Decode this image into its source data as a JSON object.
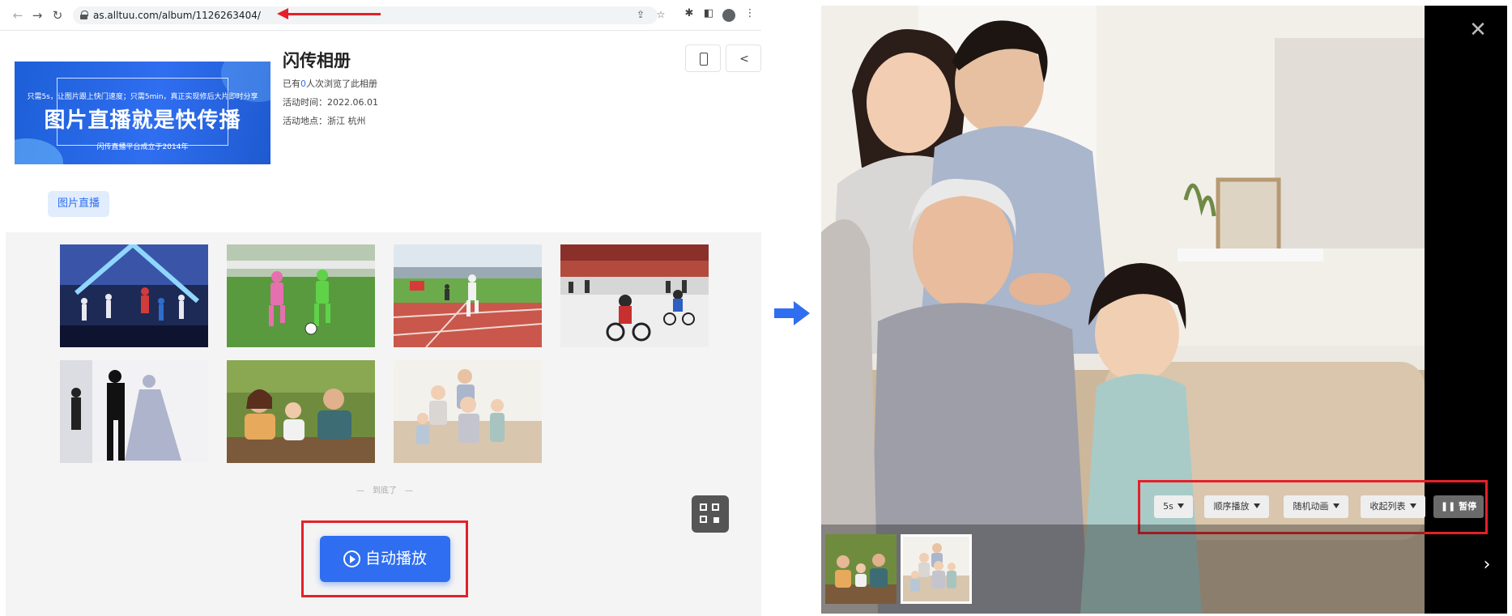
{
  "browser": {
    "url": "as.alltuu.com/album/1126263404/",
    "nav_back": "←",
    "nav_forward": "→",
    "nav_reload": "↻"
  },
  "album": {
    "cover_subline": "只需5s，让图片跟上快门速度；只需5min，真正实现修后大片即时分享",
    "cover_headline": "图片直播就是快传播",
    "cover_footer": "闪传直播平台成立于2014年",
    "title": "闪传相册",
    "views_prefix": "已有",
    "views_count": "0",
    "views_suffix": "人次浏览了此相册",
    "date_label": "活动时间：",
    "date_value": "2022.06.01",
    "location_label": "活动地点：",
    "location_value": "浙江 杭州",
    "tab_label": "图片直播",
    "end_note": "—　到底了　—",
    "autoplay_label": "自动播放"
  },
  "gallery": [
    {
      "name": "photo-dance-stage"
    },
    {
      "name": "photo-kids-football"
    },
    {
      "name": "photo-track-running"
    },
    {
      "name": "photo-balance-bike"
    },
    {
      "name": "photo-ballroom"
    },
    {
      "name": "photo-family-outdoor"
    },
    {
      "name": "photo-family-sofa"
    }
  ],
  "viewer": {
    "close_icon": "close-icon",
    "interval_label": "5s",
    "order_label": "顺序播放",
    "animation_label": "随机动画",
    "list_label": "收起列表",
    "pause_label": "❚❚ 暂停",
    "next_icon": "chevron-right-icon"
  },
  "colors": {
    "accent": "#2f6ef0",
    "highlight": "#e5202a"
  }
}
